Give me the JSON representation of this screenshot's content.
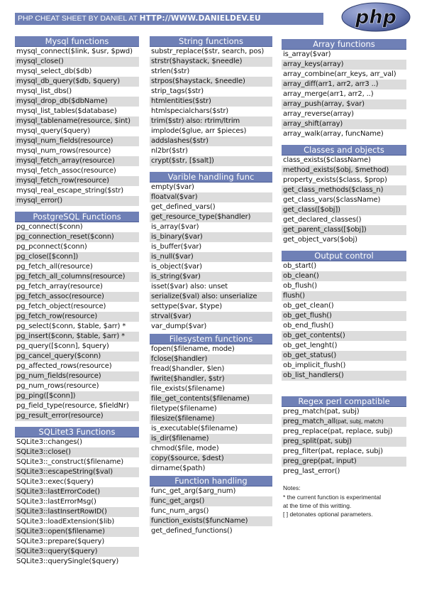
{
  "header": {
    "banner_prefix": "PHP CHEAT SHEET BY DANIEL AT ",
    "banner_url": "HTTP://WWW.DANIELDEV.EU",
    "logo_text": "php",
    "accent_color": "#6f80b6",
    "stripe_color": "#dcdcdc"
  },
  "sections": {
    "mysql": {
      "title": "Mysql functions",
      "items": [
        "mysql_connect($link, $usr, $pwd)",
        "mysql_close()",
        "mysql_select_db($db)",
        "mysql_db_query($db, $query)",
        "mysql_list_dbs()",
        "mysql_drop_db($dbName)",
        "mysql_list_tables($database)",
        "mysql_tablename(resource, $int)",
        "mysql_query($query)",
        "mysql_num_fields(resource)",
        "mysql_num_rows(resource)",
        "mysql_fetch_array(resource)",
        "mysql_fetch_assoc(resource)",
        "mysql_fetch_row(resource)",
        "mysql_real_escape_string($str)",
        "mysql_error()"
      ]
    },
    "postgresql": {
      "title": "PostgreSQL Functions",
      "items": [
        "pg_connect($conn)",
        "pg_connection_reset($conn)",
        "pg_pconnect($conn)",
        "pg_close([$conn])",
        "pg_fetch_all(resource)",
        "pg_fetch_all_columns(resource)",
        "pg_fetch_array(resource)",
        "pg_fetch_assoc(resource)",
        "pg_fetch_object(resource)",
        "pg_fetch_row(resource)",
        "pg_select($conn, $table, $arr) *",
        "pg_insert($conn, $table, $arr) *",
        "pg_query([$conn], $query)",
        "pg_cancel_query($conn)",
        "pg_affected_rows(resource)",
        "pg_num_fields(resource)",
        "pg_num_rows(resource)",
        "pg_ping([$conn])",
        "pg_field_type(resource, $fieldNr)",
        "pg_result_error(resource)"
      ]
    },
    "sqlite3": {
      "title": "SQLitet3 Functions",
      "items": [
        "SQLite3::changes()",
        "SQLite3::close()",
        "SQLite3::_construct($filename)",
        "SQLite3::escapeString($val)",
        "SQLite3::exec($query)",
        "SQLite3::lastErrorCode()",
        "SQLite3::lastErrorMsg()",
        "SQLite3::lastInsertRowID()",
        "SQLite3::loadExtension($lib)",
        "SQLite3::open($filename)",
        "SQLite3::prepare($query)",
        "SQLite3::query($query)",
        "SQLite3::querySingle($query)"
      ]
    },
    "string": {
      "title": "String functions",
      "items": [
        "substr_replace($str, search, pos)",
        "strstr($haystack, $needle)",
        "strlen($str)",
        "strpos($haystack, $needle)",
        "strip_tags($str)",
        "htmlentities($str)",
        "htmlspecialchars($str)",
        "trim($str) also: rtrim/ltrim",
        "implode($glue, arr $pieces)",
        "addslashes($str)",
        "nl2br($str)",
        "crypt($str, [$salt])"
      ]
    },
    "variable": {
      "title": "Varible handling func",
      "items": [
        "empty($var)",
        "floatval($var)",
        "get_defined_vars()",
        "get_resource_type($handler)",
        "is_array($var)",
        "is_binary($var)",
        "is_buffer($var)",
        "is_null($var)",
        "is_object($var)",
        "is_string($var)",
        "isset($var) also: unset",
        "serialize($val) also: unserialize",
        "settype($var, $type)",
        "strval($var)",
        "var_dump($var)"
      ]
    },
    "filesystem": {
      "title": "Filesystem functions",
      "items": [
        "fopen($filename, mode)",
        "fclose($handler)",
        "fread($handler, $len)",
        "fwrite($handler, $str)",
        "file_exists($filename)",
        "file_get_contents($filename)",
        "filetype($filename)",
        "filesize($filename)",
        "is_executable($filename)",
        "is_dir($filename)",
        "chmod($file, mode)",
        "copy($source, $dest)",
        "dirname($path)"
      ]
    },
    "function_handling": {
      "title": "Function handling",
      "items": [
        "func_get_arg($arg_num)",
        "func_get_args()",
        "func_num_args()",
        "function_exists($funcName)",
        "get_defined_functions()"
      ]
    },
    "array": {
      "title": "Array functions",
      "items": [
        "is_array($var)",
        "array_keys(array)",
        "array_combine(arr_keys, arr_val)",
        "array_diff(arr1, arr2, arr3 ..)",
        "array_merge(arr1, arr2, ..)",
        "array_push(array, $var)",
        "array_reverse(array)",
        "array_shift(array)",
        "array_walk(array, funcName)"
      ]
    },
    "classes": {
      "title": "Classes and objects",
      "items": [
        "class_exists($className)",
        "method_exists($obj, $method)",
        "property_exists($class, $prop)",
        "get_class_methods($class_n)",
        "get_class_vars($className)",
        "get_class([$obj])",
        "get_declared_classes()",
        "get_parent_class([$obj])",
        "get_object_vars($obj)"
      ]
    },
    "output": {
      "title": "Output control",
      "items": [
        "ob_start()",
        "ob_clean()",
        "ob_flush()",
        "flush()",
        "ob_get_clean()",
        "ob_get_flush()",
        "ob_end_flush()",
        "ob_get_contents()",
        "ob_get_lenght()",
        "ob_get_status()",
        "ob_implicit_flush()",
        "ob_list_handlers()"
      ]
    },
    "regex": {
      "title": "Regex perl compatible",
      "items": [
        "preg_match(pat, subj)",
        "preg_match_all(pat, subj, match)",
        "preg_replace(pat, replace, subj)",
        "preg_split(pat, subj)",
        "preg_filter(pat, replace, subj)",
        "preg_grep(pat, input)",
        "preg_last_error()"
      ]
    }
  },
  "notes": {
    "heading": "Notes:",
    "lines": [
      "* the current function is experimental",
      "at the time of this writting.",
      "[ ] detonates optional parameters."
    ]
  }
}
